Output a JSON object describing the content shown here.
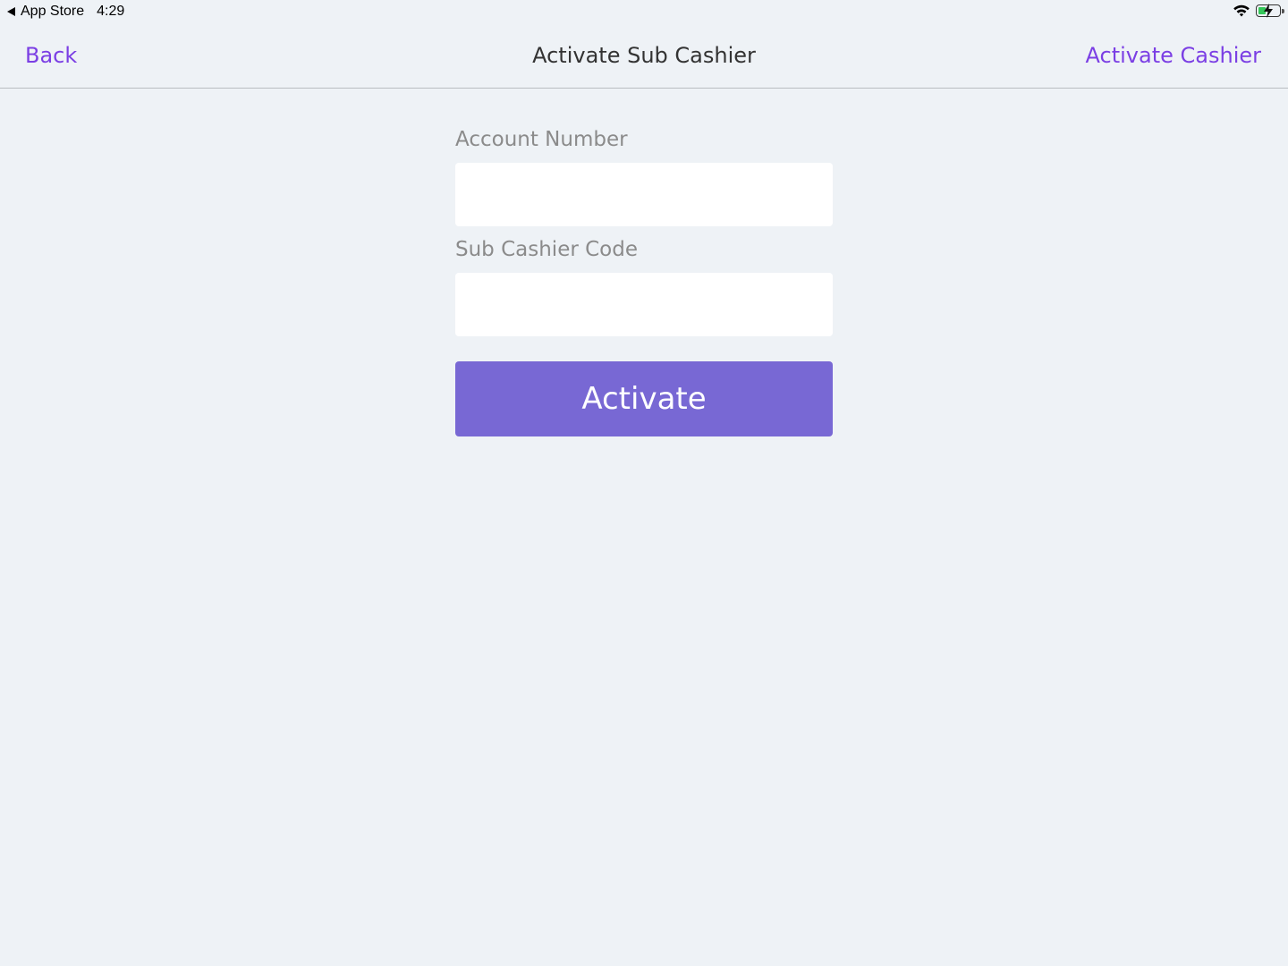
{
  "status_bar": {
    "back_app": "App Store",
    "time": "4:29",
    "icons": [
      "back-triangle-icon",
      "wifi-icon",
      "battery-charging-icon"
    ],
    "battery_color": "#34c759",
    "battery_level": 0.35
  },
  "nav": {
    "back_label": "Back",
    "title": "Activate Sub Cashier",
    "right_label": "Activate Cashier",
    "accent_color": "#7b3fe4"
  },
  "form": {
    "account_number_label": "Account Number",
    "account_number_value": "",
    "sub_cashier_code_label": "Sub Cashier Code",
    "sub_cashier_code_value": "",
    "activate_label": "Activate",
    "button_color": "#7868d4"
  }
}
